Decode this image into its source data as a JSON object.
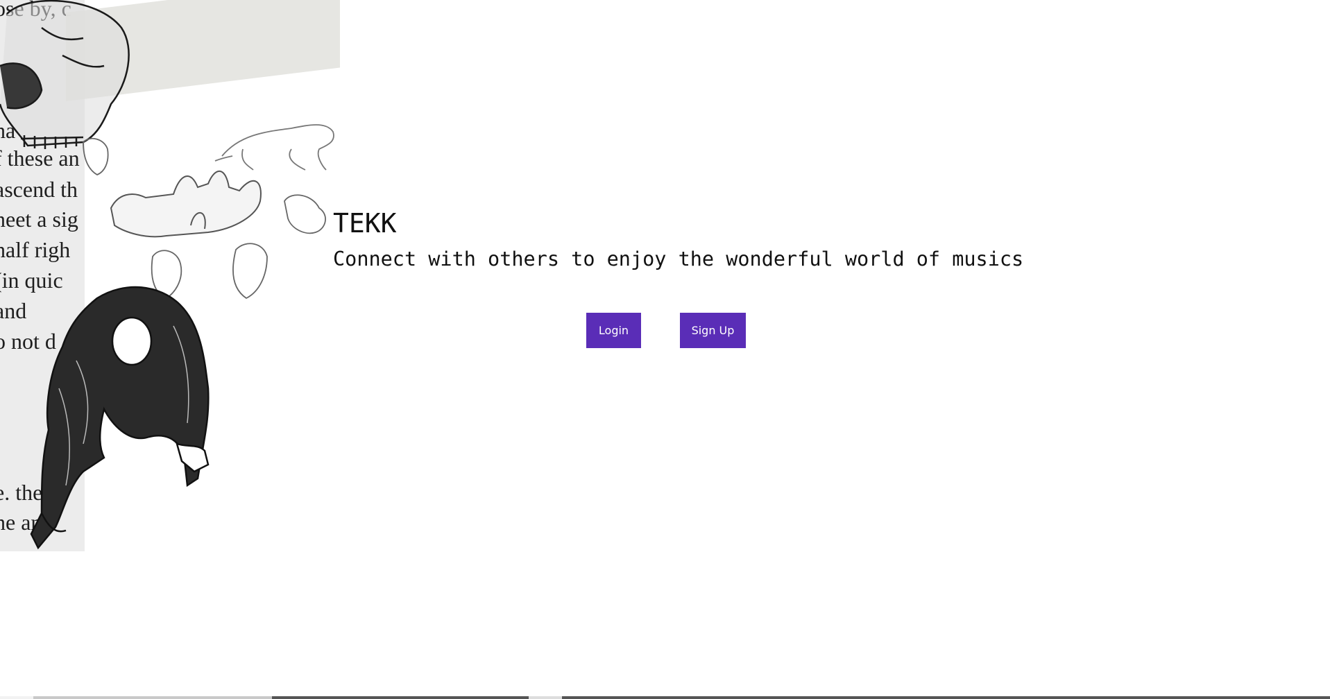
{
  "hero": {
    "title": "TEKK",
    "tagline": "Connect with others to enjoy the wonderful world of musics"
  },
  "actions": {
    "login_label": "Login",
    "signup_label": "Sign Up"
  },
  "collage": {
    "book_text": [
      "ose by, c",
      "ha",
      "f these an",
      "ascend th",
      "neet a sig",
      "half righ",
      "(in  quic",
      " and",
      "o not d",
      "e.  the",
      "he  an"
    ]
  },
  "colors": {
    "accent": "#5a2db7",
    "text": "#111111",
    "background": "#ffffff"
  },
  "icons": {
    "collage_art": "anatomy-sketch-collage"
  }
}
